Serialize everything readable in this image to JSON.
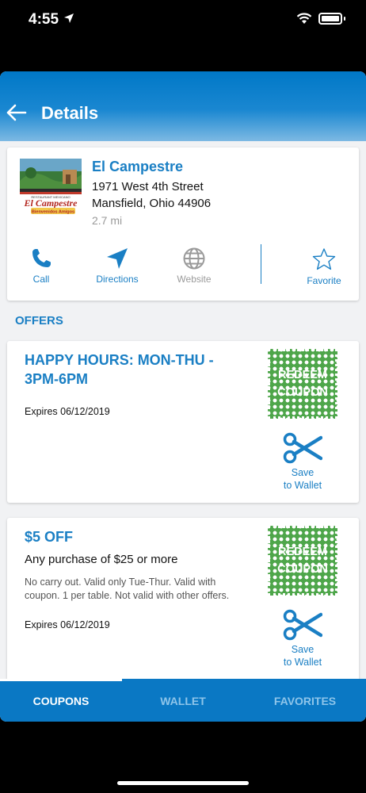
{
  "status_bar": {
    "time": "4:55",
    "icons": [
      "location-arrow-icon",
      "wifi-icon",
      "battery-icon"
    ]
  },
  "header": {
    "title": "Details",
    "back_icon": "back-arrow-icon"
  },
  "merchant": {
    "name": "El Campestre",
    "address_line1": "1971 West 4th Street",
    "address_line2": "Mansfield, Ohio 44906",
    "distance": "2.7 mi",
    "logo": {
      "top_text": "RESTAURANT MEXICANO",
      "brand": "El Campestre",
      "tagline": "Bienvenidos Amigos"
    },
    "actions": [
      {
        "label": "Call",
        "icon": "phone-icon",
        "enabled": true
      },
      {
        "label": "Directions",
        "icon": "navigation-arrow-icon",
        "enabled": true
      },
      {
        "label": "Website",
        "icon": "globe-icon",
        "enabled": false
      },
      {
        "label": "Favorite",
        "icon": "star-outline-icon",
        "enabled": true
      }
    ]
  },
  "offers_section": {
    "title": "OFFERS"
  },
  "offers": [
    {
      "title": "HAPPY HOURS: MON-THU - 3PM-6PM",
      "subtitle": "",
      "description": "",
      "expires": "Expires 06/12/2019",
      "redeem_label": "REDEEM COUPON",
      "save_label_1": "Save",
      "save_label_2": "to Wallet"
    },
    {
      "title": "$5 OFF",
      "subtitle": "Any purchase of $25 or more",
      "description": "No carry out. Valid only Tue-Thur. Valid with coupon.  1 per table. Not valid with other offers.",
      "expires": "Expires 06/12/2019",
      "redeem_label": "REDEEM COUPON",
      "save_label_1": "Save",
      "save_label_2": "to Wallet"
    }
  ],
  "tabs": [
    {
      "label": "COUPONS",
      "active": true
    },
    {
      "label": "WALLET",
      "active": false
    },
    {
      "label": "FAVORITES",
      "active": false
    }
  ],
  "colors": {
    "brand_blue": "#1a7fc4",
    "header_blue": "#0078c7",
    "tabbar_blue": "#0a78c4",
    "coupon_green": "#4ea64a",
    "muted_gray": "#9a9a9a"
  }
}
